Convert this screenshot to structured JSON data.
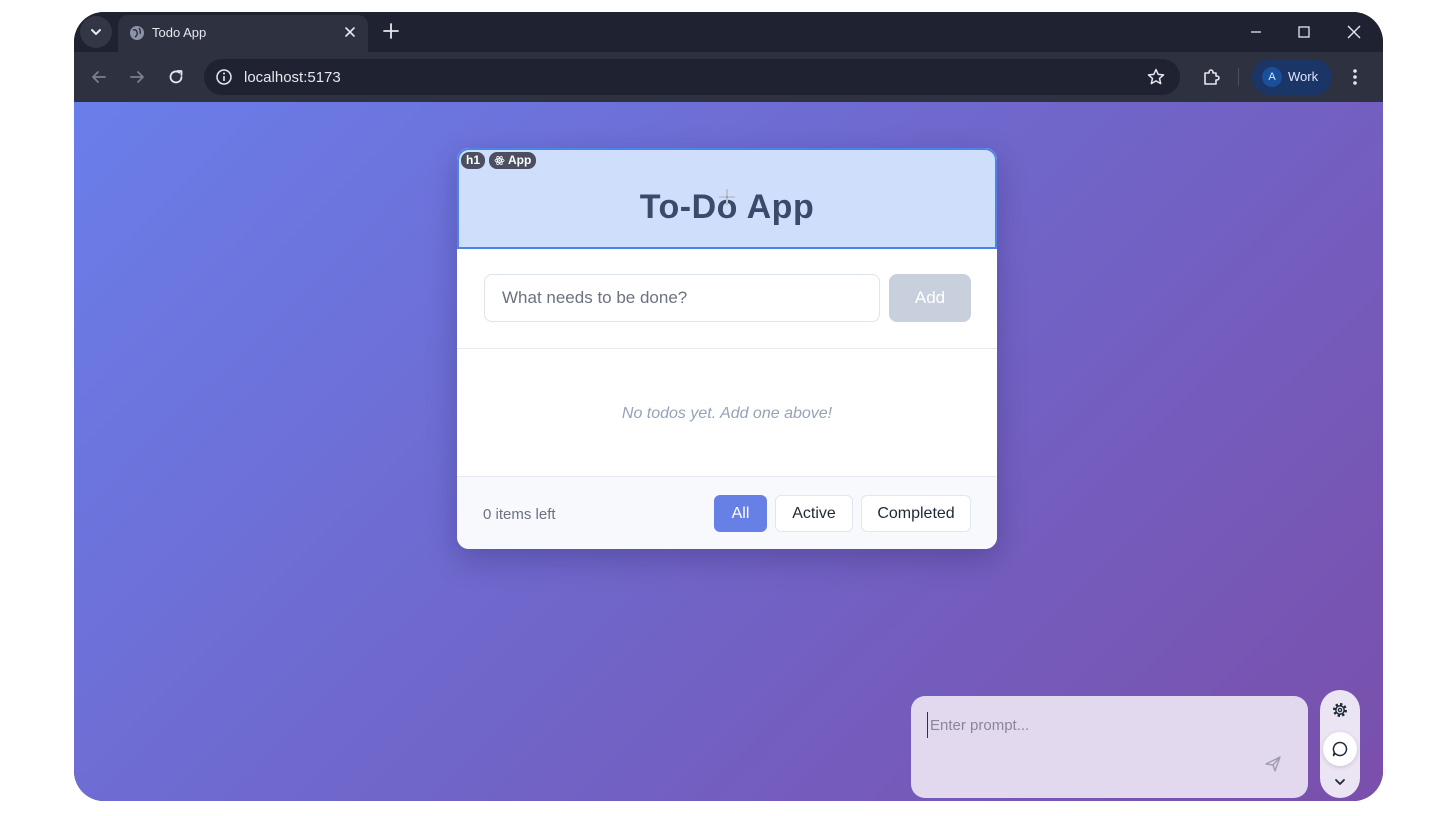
{
  "browser": {
    "tab_title": "Todo App",
    "url": "localhost:5173",
    "profile_initial": "A",
    "profile_label": "Work"
  },
  "devtools_badges": {
    "element_tag": "h1",
    "component": "App"
  },
  "app": {
    "title": "To-Do App",
    "input_placeholder": "What needs to be done?",
    "add_label": "Add",
    "empty_message": "No todos yet. Add one above!",
    "items_left": "0 items left",
    "filters": {
      "all": "All",
      "active": "Active",
      "completed": "Completed",
      "selected": "All"
    }
  },
  "assistant": {
    "prompt_placeholder": "Enter prompt..."
  },
  "colors": {
    "accent": "#6780e6",
    "header_bg": "#cfdefa",
    "header_outline": "#4b83e8",
    "background_start": "#6a7eea",
    "background_end": "#7a4fab"
  }
}
